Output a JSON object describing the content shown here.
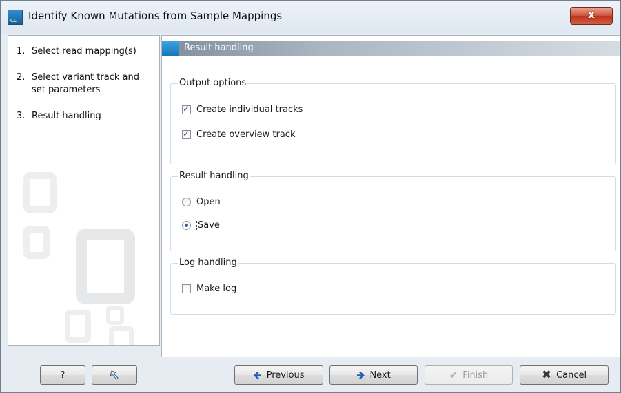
{
  "window": {
    "title": "Identify Known Mutations from Sample Mappings",
    "app_icon_text": "CL",
    "close_label": "x"
  },
  "steps": [
    {
      "num": "1.",
      "label": "Select read mapping(s)"
    },
    {
      "num": "2.",
      "label": "Select variant track and set parameters"
    },
    {
      "num": "3.",
      "label": "Result handling"
    }
  ],
  "panel": {
    "header": "Result handling"
  },
  "output_options": {
    "title": "Output options",
    "options": [
      {
        "label": "Create individual tracks",
        "checked": true
      },
      {
        "label": "Create overview track",
        "checked": true
      }
    ]
  },
  "result_handling": {
    "title": "Result handling",
    "options": [
      {
        "label": "Open",
        "selected": false
      },
      {
        "label": "Save",
        "selected": true
      }
    ]
  },
  "log_handling": {
    "title": "Log handling",
    "options": [
      {
        "label": "Make log",
        "checked": false
      }
    ]
  },
  "buttons": {
    "help": "?",
    "reset_icon": "undo-arrow-icon",
    "previous": "Previous",
    "next": "Next",
    "finish": "Finish",
    "cancel": "Cancel"
  }
}
